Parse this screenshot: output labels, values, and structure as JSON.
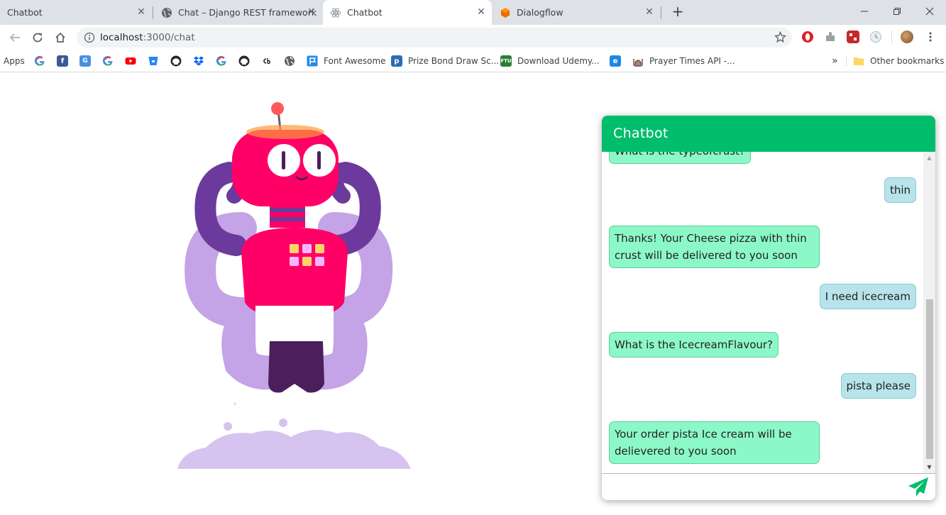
{
  "browser": {
    "tabs": [
      {
        "title": "Chatbot",
        "icon": "page-icon"
      },
      {
        "title": "Chat – Django REST framework",
        "icon": "globe-icon"
      },
      {
        "title": "Chatbot",
        "icon": "react-icon",
        "active": true
      },
      {
        "title": "Dialogflow",
        "icon": "dialogflow-icon"
      }
    ],
    "new_tab": "+",
    "close_glyph": "✕",
    "url_host": "localhost",
    "url_path": ":3000/chat"
  },
  "bookmarks": {
    "apps_label": "Apps",
    "items": [
      {
        "label": "Font Awesome",
        "icon": "font-awesome-icon"
      },
      {
        "label": "Prize Bond Draw Sc...",
        "icon": "prize-bond-icon"
      },
      {
        "label": "Download Udemy...",
        "icon": "ftu-icon"
      },
      {
        "label": "Prayer Times API -...",
        "icon": "mosque-icon"
      }
    ],
    "more_label": "»",
    "other_label": "Other bookmarks"
  },
  "colors": {
    "header_green": "#00bd6c",
    "bot_bubble": "#8cf8c8",
    "user_bubble": "#b7e3ea"
  },
  "chat": {
    "title": "Chatbot",
    "messages": [
      {
        "from": "bot",
        "text": "What is the typeofcrust?"
      },
      {
        "from": "user",
        "text": "thin"
      },
      {
        "from": "bot",
        "text": "Thanks! Your Cheese pizza with thin crust will be delivered to you soon"
      },
      {
        "from": "user",
        "text": "I need icecream"
      },
      {
        "from": "bot",
        "text": "What is the IcecreamFlavour?"
      },
      {
        "from": "user",
        "text": "pista please"
      },
      {
        "from": "bot",
        "text": "Your order pista Ice cream will be delievered to you soon"
      }
    ],
    "input_value": "",
    "send_icon": "paper-plane-icon"
  }
}
